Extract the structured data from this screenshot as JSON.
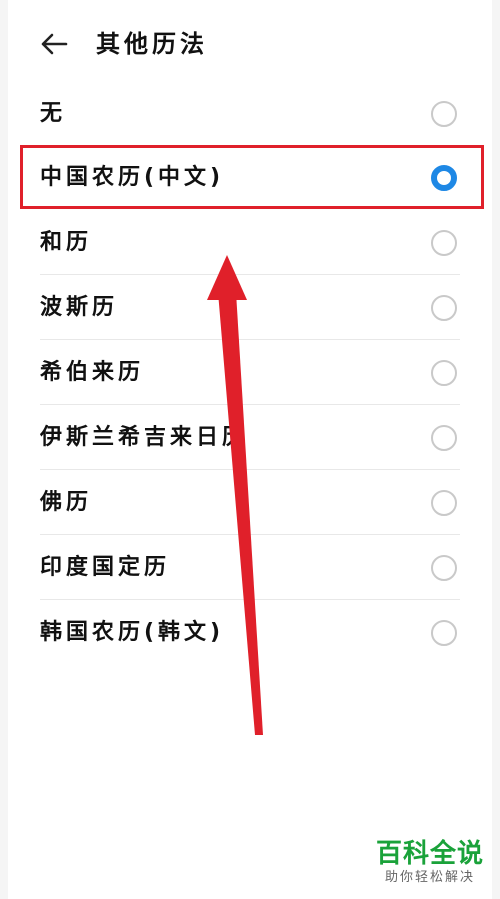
{
  "header": {
    "title": "其他历法",
    "back_icon": "arrow-left-icon"
  },
  "options": [
    {
      "label": "无",
      "selected": false
    },
    {
      "label": "中国农历(中文)",
      "selected": true
    },
    {
      "label": "和历",
      "selected": false
    },
    {
      "label": "波斯历",
      "selected": false
    },
    {
      "label": "希伯来历",
      "selected": false
    },
    {
      "label": "伊斯兰希吉来日历",
      "selected": false
    },
    {
      "label": "佛历",
      "selected": false
    },
    {
      "label": "印度国定历",
      "selected": false
    },
    {
      "label": "韩国农历(韩文)",
      "selected": false
    }
  ],
  "colors": {
    "accent": "#1e88e5",
    "annotation": "#e0202a",
    "watermark": "#1aa23a"
  },
  "watermark": {
    "title": "百科全说",
    "subtitle": "助你轻松解决"
  }
}
